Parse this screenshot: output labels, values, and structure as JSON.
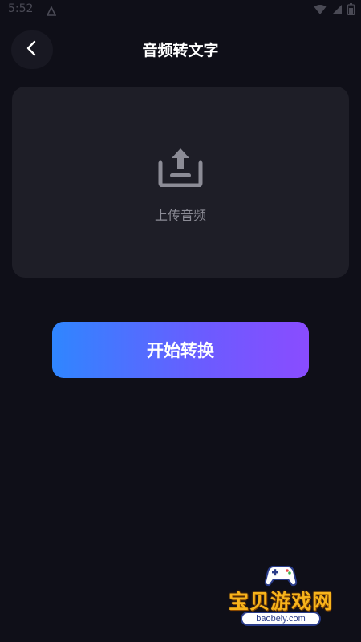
{
  "status_bar": {
    "time": "5:52"
  },
  "header": {
    "title": "音频转文字",
    "back_icon": "chevron-left-icon"
  },
  "upload": {
    "icon": "upload-icon",
    "label": "上传音频"
  },
  "actions": {
    "start_label": "开始转换"
  },
  "watermark": {
    "brand": "宝贝游戏网",
    "url": "baobeiy.com"
  },
  "colors": {
    "background": "#0f0f18",
    "card": "#1e1e27",
    "gradient_start": "#2f86ff",
    "gradient_end": "#8a4cff",
    "muted_text": "#8c8c96"
  }
}
